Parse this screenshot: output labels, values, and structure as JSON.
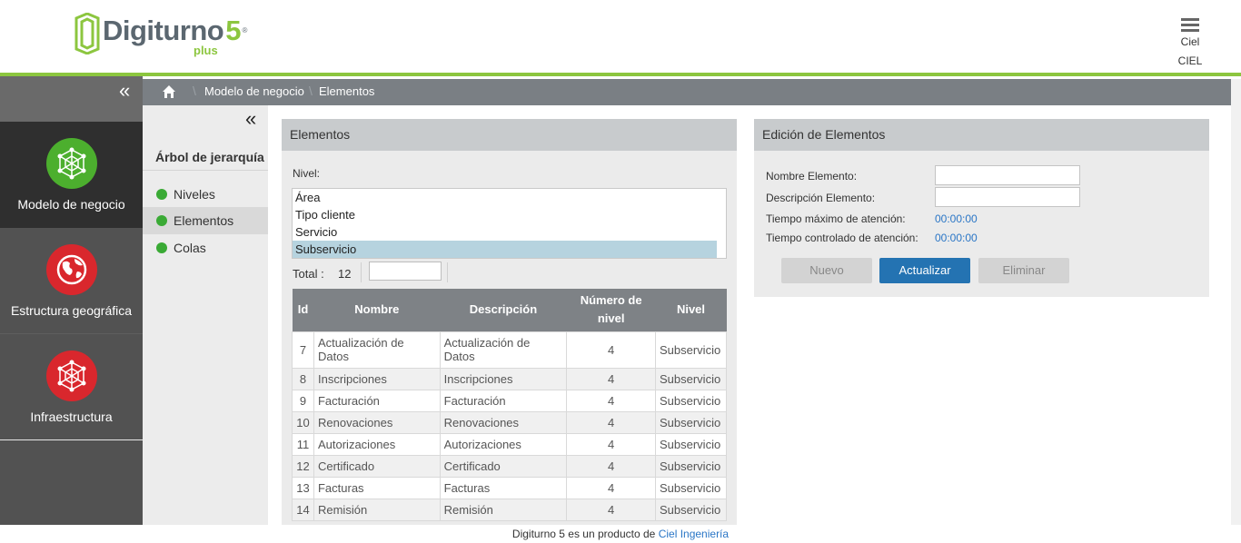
{
  "brand": {
    "name": "Digiturno",
    "version": "5",
    "registered": "®",
    "edition": "plus"
  },
  "user": {
    "name": "Ciel",
    "company": "CIEL"
  },
  "icons": {
    "menu": "hamburger-icon",
    "collapse": "double-chevron-left-icon",
    "home": "home-icon"
  },
  "sidebar": {
    "collapse_glyph": "«",
    "items": [
      {
        "label": "Modelo de negocio",
        "icon": "network-cube-icon",
        "color": "#4caf2e"
      },
      {
        "label": "Estructura geográfica",
        "icon": "globe-icon",
        "color": "#d9272d"
      },
      {
        "label": "Infraestructura",
        "icon": "network-cube-icon",
        "color": "#d9272d"
      }
    ]
  },
  "breadcrumb": {
    "item1": "Modelo de negocio",
    "item2": "Elementos"
  },
  "tree": {
    "title": "Árbol de jerarquía",
    "items": [
      {
        "label": "Niveles"
      },
      {
        "label": "Elementos"
      },
      {
        "label": "Colas"
      }
    ]
  },
  "elements_panel": {
    "title": "Elementos",
    "nivel_label": "Nivel:",
    "nivel_options": [
      "Área",
      "Tipo cliente",
      "Servicio",
      "Subservicio"
    ],
    "nivel_selected": "Subservicio",
    "total_label": "Total :",
    "total_value": "12",
    "search_value": "",
    "table": {
      "headers": [
        "Id",
        "Nombre",
        "Descripción",
        "Número de nivel",
        "Nivel"
      ],
      "rows": [
        [
          "7",
          "Actualización de Datos",
          "Actualización de Datos",
          "4",
          "Subservicio"
        ],
        [
          "8",
          "Inscripciones",
          "Inscripciones",
          "4",
          "Subservicio"
        ],
        [
          "9",
          "Facturación",
          "Facturación",
          "4",
          "Subservicio"
        ],
        [
          "10",
          "Renovaciones",
          "Renovaciones",
          "4",
          "Subservicio"
        ],
        [
          "11",
          "Autorizaciones",
          "Autorizaciones",
          "4",
          "Subservicio"
        ],
        [
          "12",
          "Certificado",
          "Certificado",
          "4",
          "Subservicio"
        ],
        [
          "13",
          "Facturas",
          "Facturas",
          "4",
          "Subservicio"
        ],
        [
          "14",
          "Remisión",
          "Remisión",
          "4",
          "Subservicio"
        ]
      ]
    }
  },
  "edit_panel": {
    "title": "Edición de Elementos",
    "nombre_label": "Nombre Elemento:",
    "nombre_value": "",
    "descripcion_label": "Descripción Elemento:",
    "descripcion_value": "",
    "tiempo_max_label": "Tiempo máximo de atención:",
    "tiempo_max_value": "00:00:00",
    "tiempo_ctrl_label": "Tiempo controlado de atención:",
    "tiempo_ctrl_value": "00:00:00",
    "btn_nuevo": "Nuevo",
    "btn_actualizar": "Actualizar",
    "btn_eliminar": "Eliminar"
  },
  "footer": {
    "text": "Digiturno 5 es un producto de",
    "link": "Ciel Ingeniería"
  },
  "colors": {
    "accent_green": "#8cc63f",
    "primary_blue": "#2473b2",
    "alert_red": "#d9272d"
  }
}
